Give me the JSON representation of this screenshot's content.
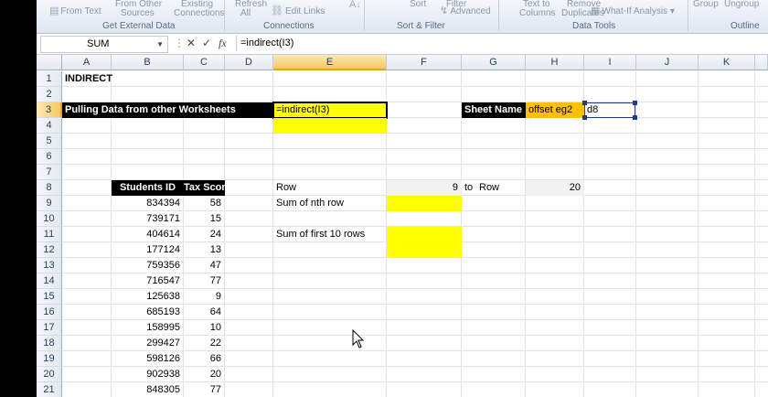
{
  "ribbon": {
    "items": [
      "From Text",
      "From Other",
      "Sources",
      "Existing",
      "Connections",
      "Refresh",
      "All",
      "Edit Links",
      "Sort",
      "Filter",
      "Advanced",
      "Text to",
      "Columns",
      "Remove",
      "Duplicates",
      "What-If Analysis",
      "Group",
      "Ungroup"
    ],
    "groups": [
      "Get External Data",
      "Connections",
      "Sort & Filter",
      "Data Tools",
      "Outline"
    ]
  },
  "formula_bar": {
    "name_box": "SUM",
    "formula": "=indirect(I3)",
    "cancel_icon": "✕",
    "enter_icon": "✓",
    "fx_icon": "fx"
  },
  "columns": [
    "A",
    "B",
    "C",
    "D",
    "E",
    "F",
    "G",
    "H",
    "I",
    "J",
    "K"
  ],
  "rows": [
    "1",
    "2",
    "3",
    "4",
    "5",
    "6",
    "7",
    "8",
    "9",
    "10",
    "11",
    "12",
    "13",
    "14",
    "15",
    "16",
    "17",
    "18",
    "19",
    "20",
    "21"
  ],
  "sheet": {
    "title": "INDIRECT",
    "banner": "Pulling Data from other Worksheets",
    "active_cell_text": "=indirect(I3)",
    "sheet_name_label": "Sheet Name",
    "sheet_name_value": "offset eg2",
    "cell_ref": "d8",
    "row_label": "Row",
    "row_from": "9",
    "to_label": "to",
    "row_label2": "Row",
    "row_to": "20",
    "sum_nth_label": "Sum of nth row",
    "sum_first_label": "Sum of first 10 rows",
    "table_headers": [
      "Students ID",
      "Tax Score"
    ],
    "table_rows": [
      [
        "834394",
        "58"
      ],
      [
        "739171",
        "15"
      ],
      [
        "404614",
        "24"
      ],
      [
        "177124",
        "13"
      ],
      [
        "759356",
        "47"
      ],
      [
        "716547",
        "77"
      ],
      [
        "125638",
        "9"
      ],
      [
        "685193",
        "64"
      ],
      [
        "158995",
        "10"
      ],
      [
        "299427",
        "22"
      ],
      [
        "598126",
        "66"
      ],
      [
        "902938",
        "20"
      ],
      [
        "848305",
        "77"
      ]
    ]
  },
  "colors": {
    "highlight_yellow": "#ffff00",
    "orange": "#ffc000",
    "header_black": "#000000"
  }
}
